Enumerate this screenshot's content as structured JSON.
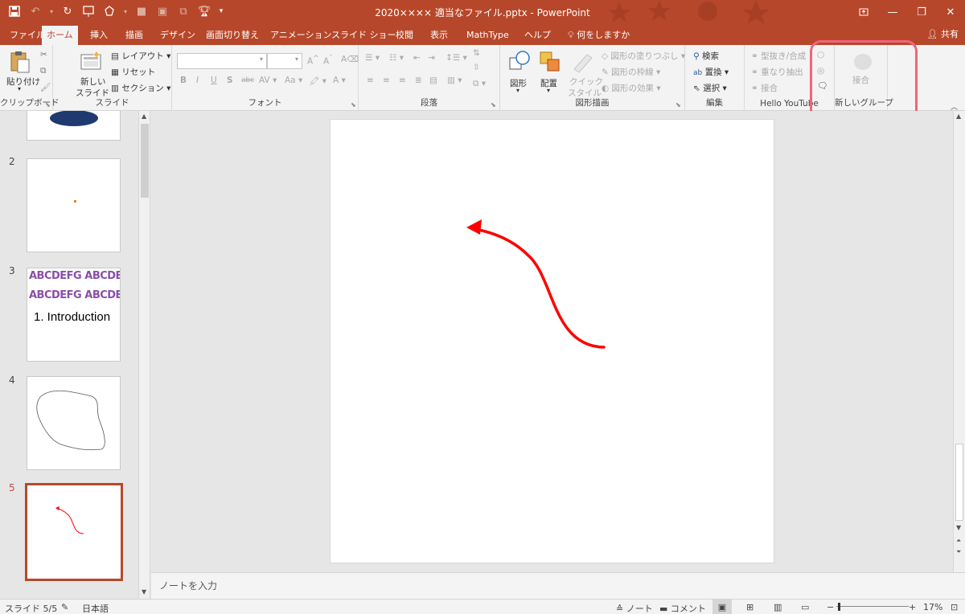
{
  "window": {
    "title": "2020×××× 適当なファイル.pptx  -  PowerPoint"
  },
  "tabs": [
    "ファイル",
    "ホーム",
    "挿入",
    "描画",
    "デザイン",
    "画面切り替え",
    "アニメーション",
    "スライド ショー",
    "校閲",
    "表示",
    "MathType",
    "ヘルプ"
  ],
  "tell_me": "何をしますか",
  "share": "共有",
  "ribbon": {
    "clipboard": {
      "paste": "貼り付け",
      "label": "クリップボード"
    },
    "slides": {
      "new_slide_line1": "新しい",
      "new_slide_line2": "スライド",
      "layout": "レイアウト",
      "reset": "リセット",
      "section": "セクション",
      "label": "スライド"
    },
    "font": {
      "bold": "B",
      "italic": "I",
      "underline": "U",
      "shadow": "S",
      "strike": "abc",
      "spacing": "AV",
      "case": "Aa",
      "color": "A",
      "grow": "A",
      "shrink": "A",
      "clear": "A",
      "label": "フォント"
    },
    "paragraph": {
      "label": "段落"
    },
    "drawing": {
      "shapes": "図形",
      "arrange": "配置",
      "quick_style_line1": "クイック",
      "quick_style_line2": "スタイル",
      "fill": "図形の塗りつぶし",
      "outline": "図形の枠線",
      "effects": "図形の効果",
      "label": "図形描画"
    },
    "editing": {
      "find": "検索",
      "replace": "置換",
      "select": "選択",
      "label": "編集"
    },
    "hello": {
      "union": "型抜き/合成",
      "intersect": "重なり抽出",
      "combine": "接合",
      "label": "Hello YouTube"
    },
    "new_group": {
      "combine": "接合",
      "label": "新しいグループ"
    }
  },
  "thumbnails": {
    "numbers": [
      "2",
      "3",
      "4",
      "5"
    ],
    "slide3_text1": "ABCDEFG ABCDEFG",
    "slide3_text2": "ABCDEFG ABCDEFG",
    "slide3_heading": "1. Introduction"
  },
  "notes_placeholder": "ノートを入力",
  "status": {
    "slide": "スライド 5/5",
    "lang": "日本語",
    "notes": "ノート",
    "comments": "コメント",
    "zoom": "17%"
  },
  "colors": {
    "accent": "#b7472a",
    "arrow": "#ff0000",
    "highlight": "#f2637c"
  }
}
